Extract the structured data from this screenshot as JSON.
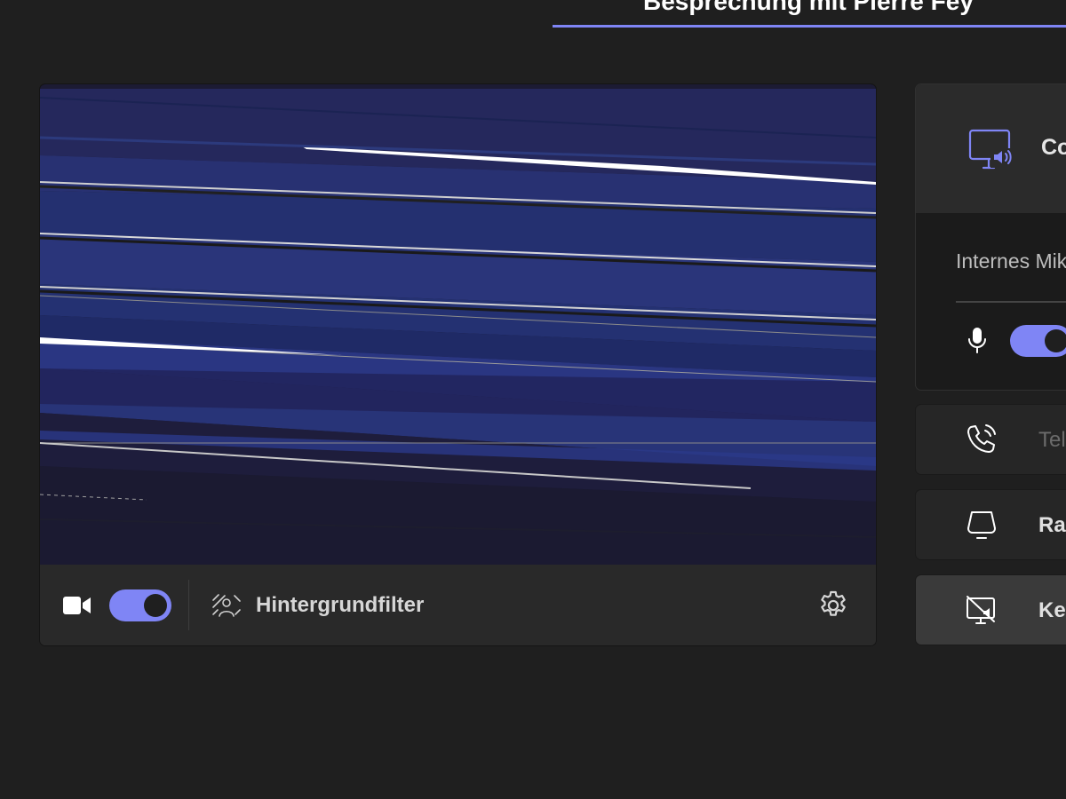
{
  "meeting": {
    "title": "Besprechung mit Pierre Fey"
  },
  "video": {
    "camera_icon": "video-camera-icon",
    "camera_on": true,
    "background_filter_label": "Hintergrundfilter",
    "background_filter_icon": "background-blur-icon",
    "settings_icon": "gear-icon"
  },
  "audio": {
    "computer_audio_label": "Computeraudio",
    "computer_audio_icon": "computer-speaker-icon",
    "device_label": "Internes Mikrofon",
    "microphone_icon": "microphone-icon",
    "microphone_on": true
  },
  "audio_options": [
    {
      "label": "Telefonaudio",
      "icon": "phone-icon",
      "enabled": false
    },
    {
      "label": "Raumaudio",
      "icon": "room-audio-icon",
      "enabled": true
    },
    {
      "label": "Kein Audio",
      "icon": "no-audio-icon",
      "enabled": true,
      "selected": true
    }
  ],
  "colors": {
    "accent": "#7f85f5",
    "background": "#1f1f1f",
    "card": "#292929",
    "selected_card": "#3a3a3a",
    "disabled_text": "#6b6b6b"
  }
}
